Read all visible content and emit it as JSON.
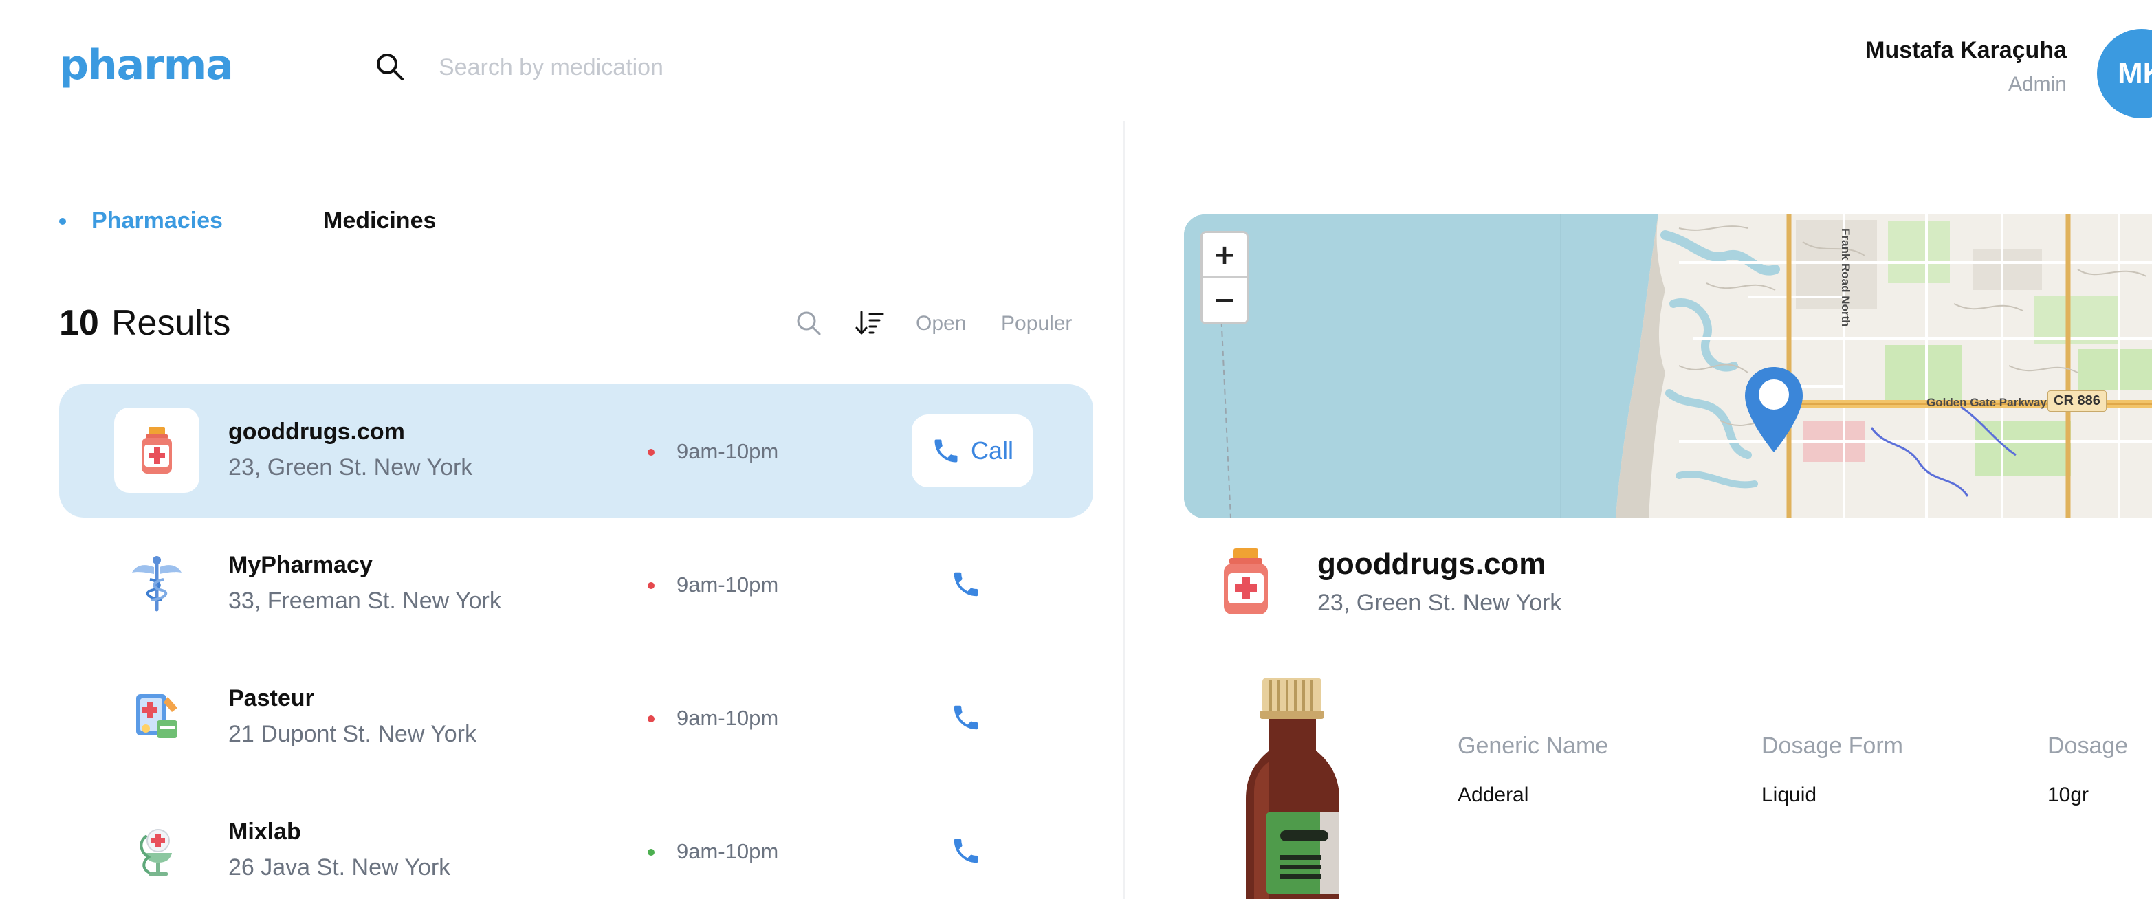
{
  "app": {
    "logo": "pharma"
  },
  "search": {
    "placeholder": "Search by medication"
  },
  "user": {
    "name": "Mustafa Karaçuha",
    "role": "Admin",
    "initials": "MK"
  },
  "tabs": [
    {
      "label": "Pharmacies",
      "active": true
    },
    {
      "label": "Medicines",
      "active": false
    }
  ],
  "results": {
    "count": "10",
    "label": "Results"
  },
  "filters": {
    "open": "Open",
    "popular": "Populer"
  },
  "colors": {
    "accent": "#3b9ae0",
    "selected_row": "#d7eaf7",
    "open_dot": "#4caf50",
    "closed_dot": "#e5484d"
  },
  "pharmacies": [
    {
      "name": "gooddrugs.com",
      "address": "23, Green St. New York",
      "hours": "9am-10pm",
      "status": "closed",
      "icon": "medicine-bottle-icon",
      "call_label": "Call",
      "selected": true
    },
    {
      "name": "MyPharmacy",
      "address": "33, Freeman St. New York",
      "hours": "9am-10pm",
      "status": "closed",
      "icon": "caduceus-icon",
      "selected": false
    },
    {
      "name": "Pasteur",
      "address": "21 Dupont St. New York",
      "hours": "9am-10pm",
      "status": "closed",
      "icon": "pharmacy-kit-icon",
      "selected": false
    },
    {
      "name": "Mixlab",
      "address": "26 Java St. New York",
      "hours": "9am-10pm",
      "status": "open",
      "icon": "bowl-of-hygieia-icon",
      "selected": false
    }
  ],
  "map": {
    "zoom_in": "+",
    "zoom_out": "−",
    "labels": {
      "golden_gate": "Golden Gate Parkway",
      "cr886": "CR 886",
      "frank_road": "Frank Road North"
    }
  },
  "detail": {
    "name": "gooddrugs.com",
    "address": "23, Green St. New York",
    "medicine": {
      "headers": [
        "Generic Name",
        "Dosage Form",
        "Dosage"
      ],
      "values": [
        "Adderal",
        "Liquid",
        "10gr"
      ]
    }
  }
}
